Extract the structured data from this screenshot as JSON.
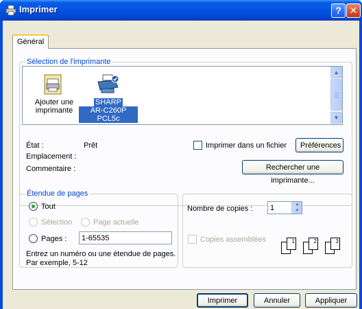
{
  "window": {
    "title": "Imprimer",
    "help_glyph": "?",
    "close_glyph": "✕"
  },
  "tabs": [
    {
      "label": "Général"
    }
  ],
  "printer_selection": {
    "legend": "Sélection de l'imprimante",
    "printers": [
      {
        "line1": "Ajouter une",
        "line2": "imprimante",
        "icon": "add-printer-icon",
        "selected": false
      },
      {
        "line1": "SHARP",
        "line2": "AR-C260P PCL5c",
        "icon": "printer-icon",
        "selected": true
      }
    ],
    "scroll": {
      "up": "▲",
      "down": "▼"
    }
  },
  "status": {
    "state_label": "État :",
    "state_value": "Prêt",
    "location_label": "Emplacement :",
    "comment_label": "Commentaire :",
    "print_to_file_label": "Imprimer dans un fichier",
    "preferences_button": "Préférences",
    "find_printer_button": "Rechercher une imprimante..."
  },
  "page_range": {
    "legend": "Étendue de pages",
    "all_label": "Tout",
    "selection_label": "Sélection",
    "current_page_label": "Page actuelle",
    "pages_label": "Pages :",
    "pages_value": "1-65535",
    "hint_line1": "Entrez un numéro ou une étendue de pages.",
    "hint_line2": "Par exemple, 5-12"
  },
  "copies": {
    "count_label": "Nombre de copies :",
    "count_value": "1",
    "collate_label": "Copies assemblées",
    "page_numbers": [
      "1",
      "1",
      "2",
      "2",
      "3",
      "3"
    ]
  },
  "footer": {
    "print_button": "Imprimer",
    "cancel_button": "Annuler",
    "apply_button": "Appliquer"
  },
  "colors": {
    "accent": "#0046d5",
    "selection": "#316ac5",
    "titlebar": "#0253e2"
  }
}
